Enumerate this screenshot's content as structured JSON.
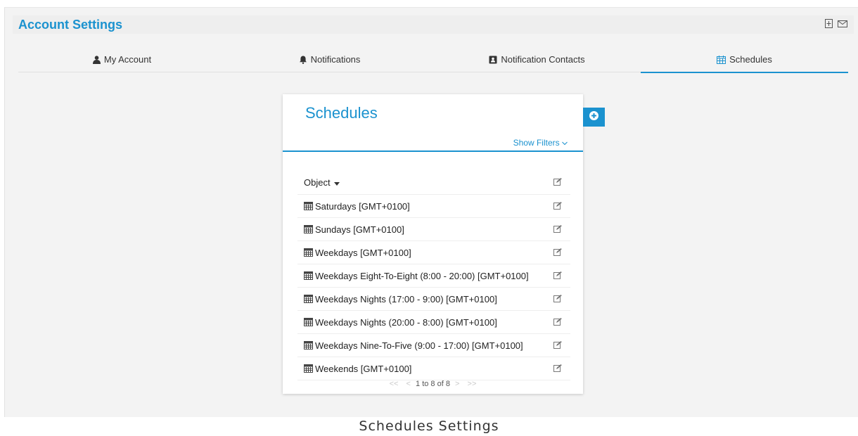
{
  "page": {
    "title": "Account Settings",
    "caption": "Schedules Settings"
  },
  "tabs": [
    {
      "label": "My Account",
      "icon": "user-icon"
    },
    {
      "label": "Notifications",
      "icon": "bell-icon"
    },
    {
      "label": "Notification Contacts",
      "icon": "contact-card-icon"
    },
    {
      "label": "Schedules",
      "icon": "calendar-icon",
      "active": true
    }
  ],
  "card": {
    "title": "Schedules",
    "show_filters": "Show Filters",
    "column_header": "Object",
    "rows": [
      "Saturdays [GMT+0100]",
      "Sundays [GMT+0100]",
      "Weekdays [GMT+0100]",
      "Weekdays Eight-To-Eight (8:00 - 20:00) [GMT+0100]",
      "Weekdays Nights (17:00 - 9:00) [GMT+0100]",
      "Weekdays Nights (20:00 - 8:00) [GMT+0100]",
      "Weekdays Nine-To-Five (9:00 - 17:00) [GMT+0100]",
      "Weekends [GMT+0100]"
    ],
    "pager": {
      "text": "1 to 8 of 8",
      "first": "<<",
      "prev": "<",
      "next": ">",
      "last": ">>"
    }
  },
  "colors": {
    "accent": "#1b92cf",
    "background": "#f3f3f3"
  }
}
